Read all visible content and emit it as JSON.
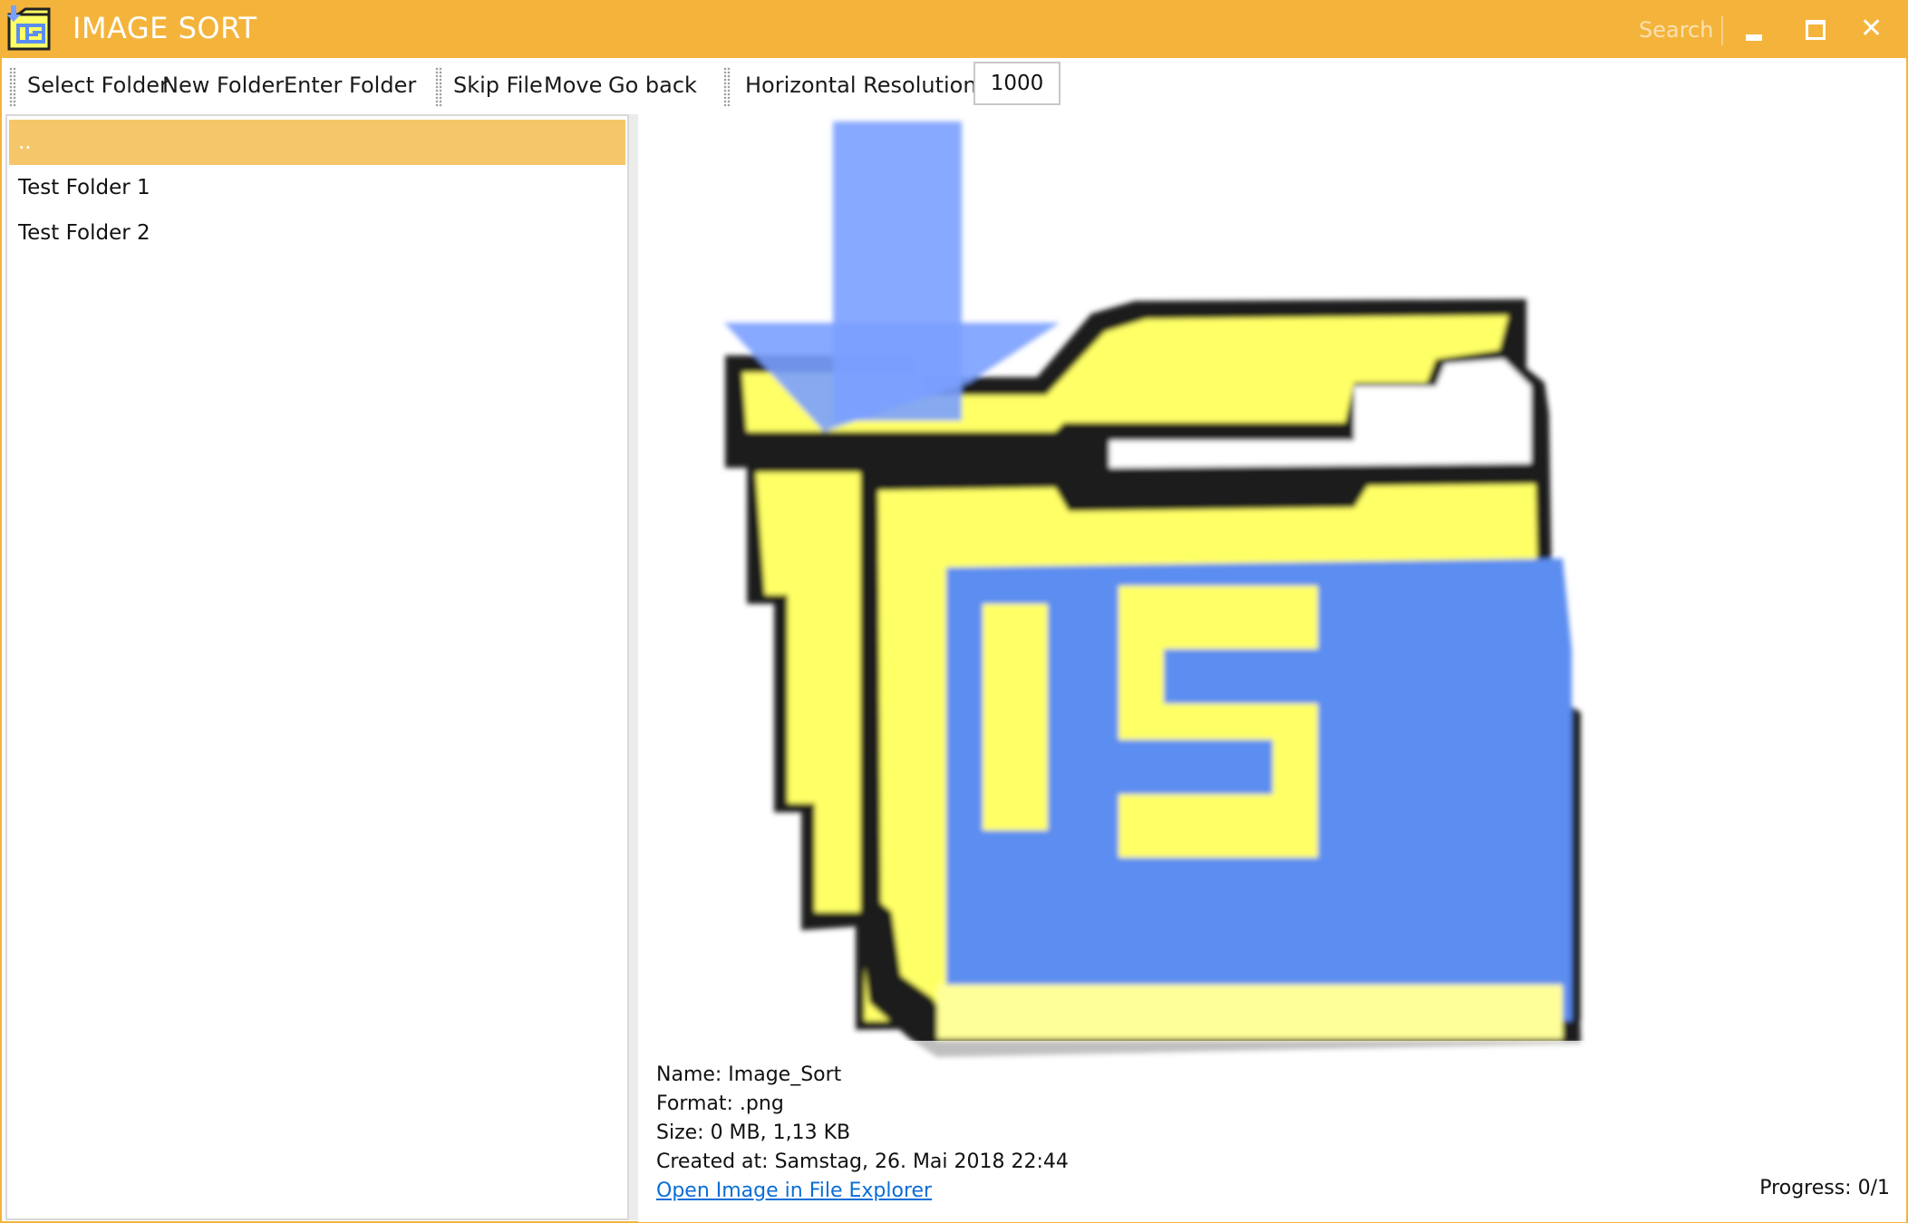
{
  "window": {
    "title": "IMAGE SORT",
    "search_label": "Search",
    "accent_color": "#f4b43c",
    "selection_color": "#f6c76a"
  },
  "toolbar": {
    "select_folder": "Select Folder",
    "new_folder": "New Folder",
    "enter_folder": "Enter Folder",
    "skip_file": "Skip File",
    "move": "Move",
    "go_back": "Go back",
    "resolution_label": "Horizontal Resolution:",
    "resolution_value": "1000"
  },
  "folders": {
    "items": [
      {
        "label": "..",
        "selected": true
      },
      {
        "label": "Test Folder 1",
        "selected": false
      },
      {
        "label": "Test Folder 2",
        "selected": false
      }
    ]
  },
  "preview": {
    "image_description_icon": "image-sort-folder-icon",
    "name_line": "Name: Image_Sort",
    "format_line": "Format: .png",
    "size_line": "Size: 0 MB, 1,13 KB",
    "created_line": "Created at: Samstag, 26. Mai 2018 22:44",
    "open_link": "Open Image in File Explorer",
    "progress": "Progress: 0/1"
  }
}
